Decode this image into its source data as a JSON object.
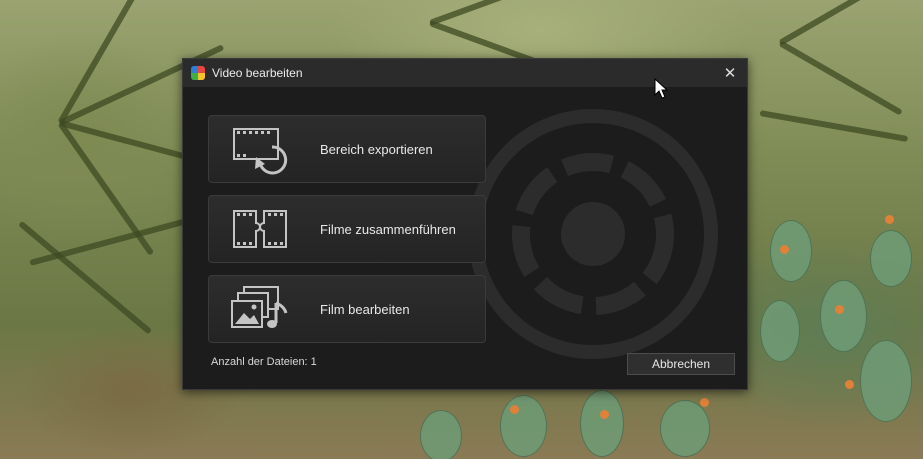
{
  "window": {
    "title": "Video bearbeiten",
    "close_icon": "close-icon"
  },
  "actions": [
    {
      "label": "Bereich exportieren",
      "icon": "filmstrip-export-icon"
    },
    {
      "label": "Filme zusammenführen",
      "icon": "filmstrip-merge-icon"
    },
    {
      "label": "Film bearbeiten",
      "icon": "media-edit-icon"
    }
  ],
  "footer": {
    "file_count_text": "Anzahl der Dateien: 1",
    "cancel_label": "Abbrechen"
  },
  "colors": {
    "dialog_bg": "#1c1c1c",
    "titlebar_bg": "#2b2b2b",
    "button_bg": "#2d2d2d",
    "text": "#e8e8e8"
  }
}
